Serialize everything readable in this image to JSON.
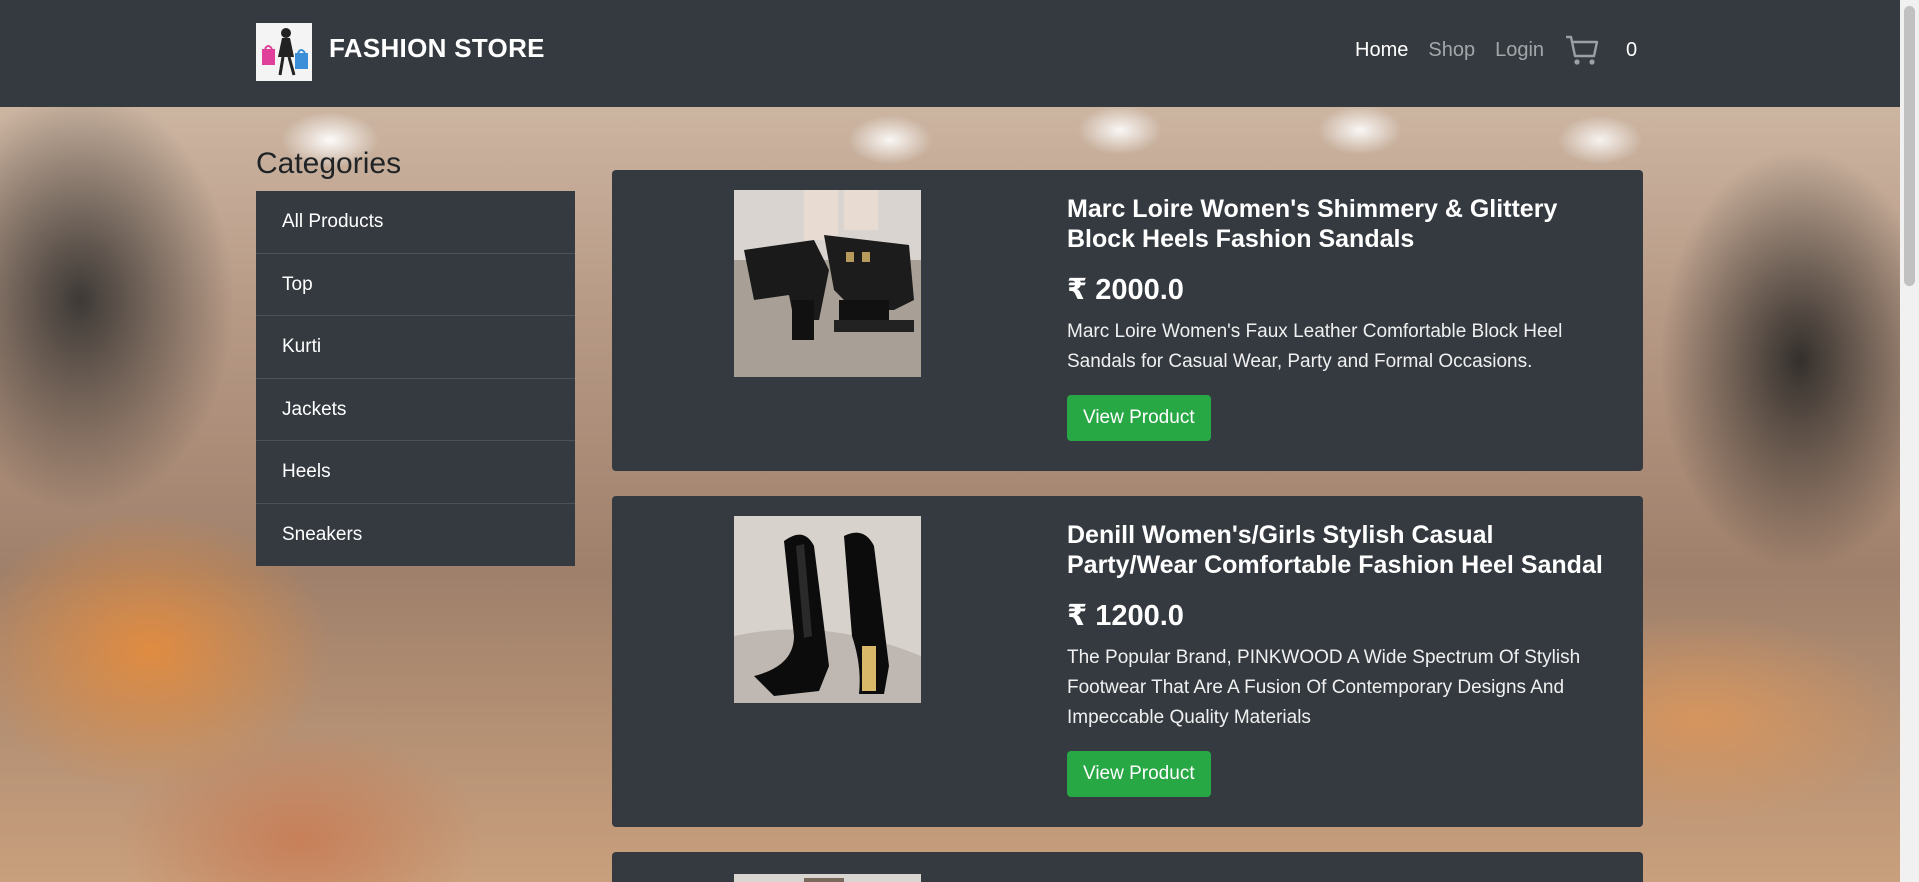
{
  "brand": {
    "name": "FASHION STORE",
    "logo_icon": "shopping-woman-logo"
  },
  "nav": {
    "links": [
      {
        "label": "Home",
        "active": true
      },
      {
        "label": "Shop",
        "active": false
      },
      {
        "label": "Login",
        "active": false
      }
    ],
    "cart_icon": "cart-icon",
    "cart_count": "0"
  },
  "sidebar": {
    "title": "Categories",
    "items": [
      {
        "label": "All Products"
      },
      {
        "label": "Top"
      },
      {
        "label": "Kurti"
      },
      {
        "label": "Jackets"
      },
      {
        "label": "Heels"
      },
      {
        "label": "Sneakers"
      }
    ]
  },
  "products": [
    {
      "title": "Marc Loire Women's Shimmery & Glittery Block Heels Fashion Sandals",
      "price": "₹ 2000.0",
      "description": "Marc Loire Women's Faux Leather Comfortable Block Heel Sandals for Casual Wear, Party and Formal Occasions.",
      "button_label": "View Product"
    },
    {
      "title": "Denill Women's/Girls Stylish Casual Party/Wear Comfortable Fashion Heel Sandal",
      "price": "₹ 1200.0",
      "description": "The Popular Brand, PINKWOOD A Wide Spectrum Of Stylish Footwear That Are A Fusion Of Contemporary Designs And Impeccable Quality Materials",
      "button_label": "View Product"
    }
  ],
  "colors": {
    "navbar": "#343a40",
    "button": "#28a745"
  }
}
